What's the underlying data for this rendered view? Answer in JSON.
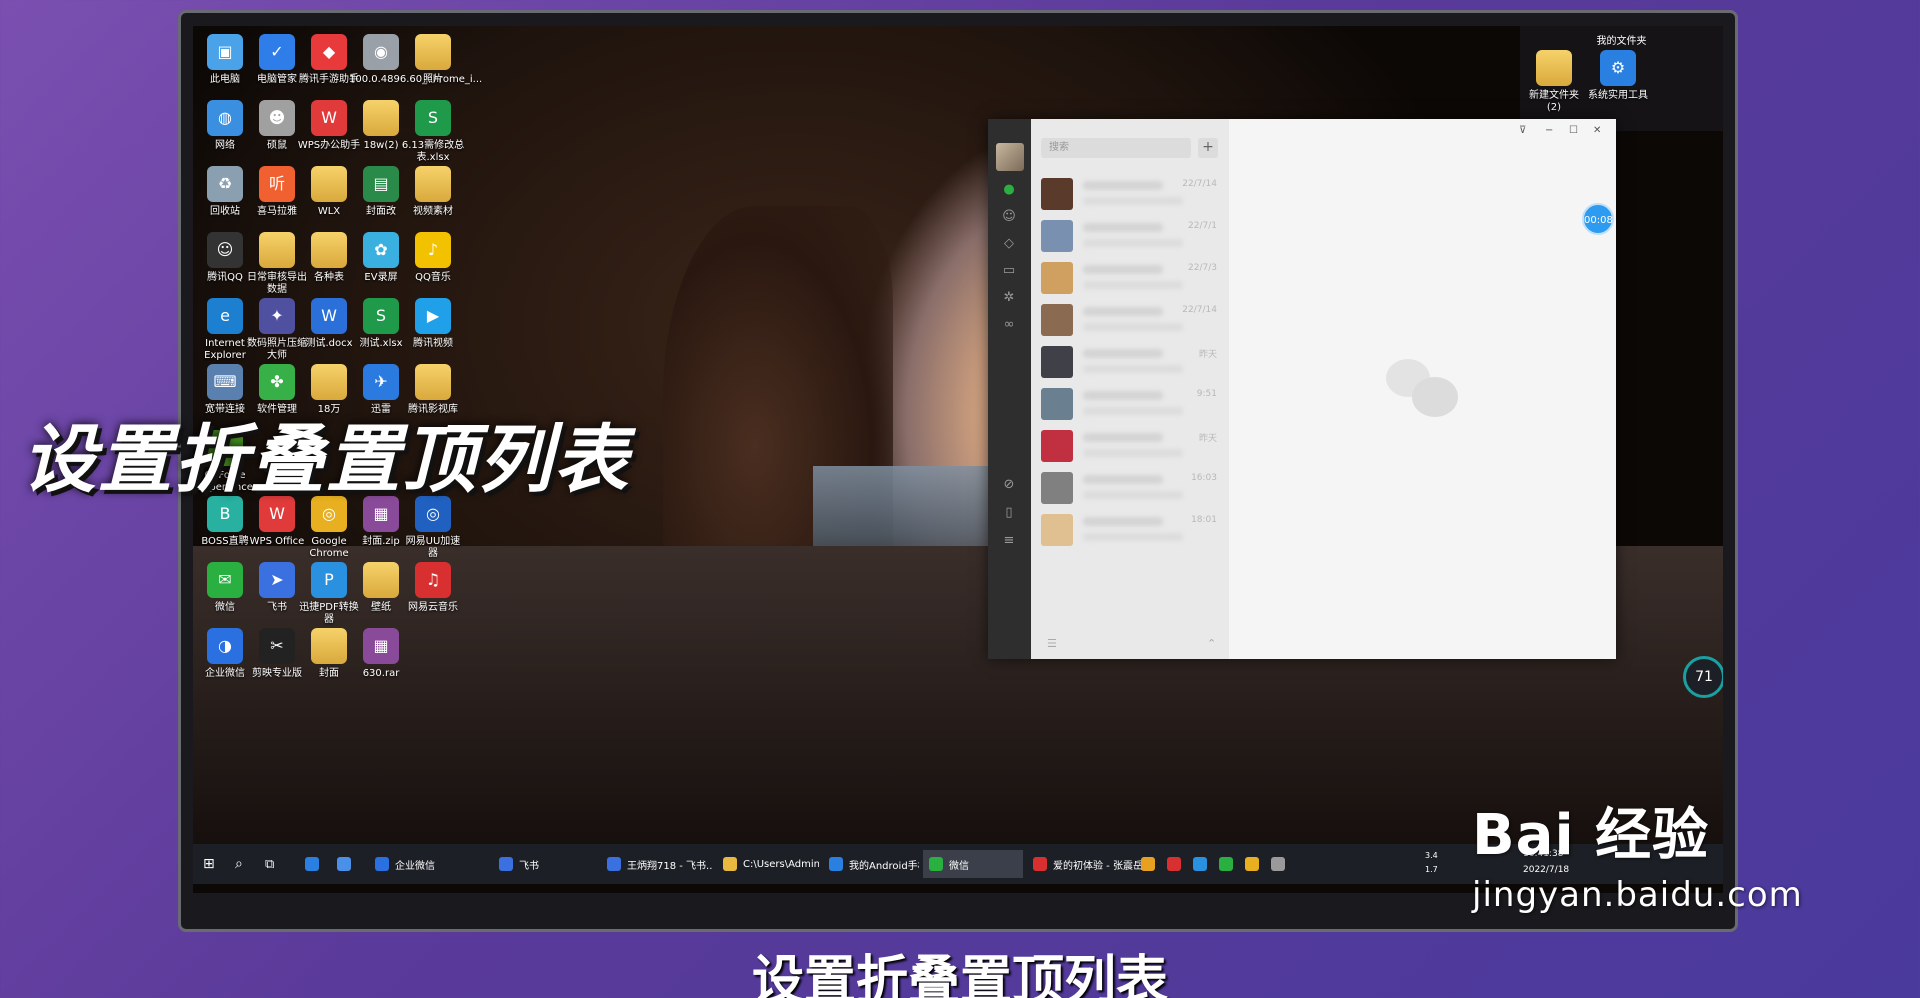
{
  "overlay_title": "设置折叠置顶列表",
  "subtitle": "设置折叠置顶列表",
  "watermark": {
    "brand": "Bai 经验",
    "url": "jingyan.baidu.com"
  },
  "desktop_icons": [
    {
      "label": "此电脑",
      "c": "#4aa3e8",
      "g": "▣"
    },
    {
      "label": "电脑管家",
      "c": "#2e7de9",
      "g": "✓"
    },
    {
      "label": "腾讯手游助手",
      "c": "#e83a3a",
      "g": "◆"
    },
    {
      "label": "100.0.4896.60_chrome_i...",
      "c": "#9aa0a8",
      "g": "◉"
    },
    {
      "label": "照片",
      "c": "folder",
      "g": ""
    },
    {
      "label": "网络",
      "c": "#3a8fe0",
      "g": "◍"
    },
    {
      "label": "硕鼠",
      "c": "#a0a0a0",
      "g": "☻"
    },
    {
      "label": "WPS办公助手",
      "c": "#e03a3a",
      "g": "W"
    },
    {
      "label": "18w(2)",
      "c": "folder",
      "g": ""
    },
    {
      "label": "6.13需修改总表.xlsx",
      "c": "#1f9a4a",
      "g": "S"
    },
    {
      "label": "回收站",
      "c": "#8aa0b0",
      "g": "♻"
    },
    {
      "label": "喜马拉雅",
      "c": "#f06030",
      "g": "听"
    },
    {
      "label": "WLX",
      "c": "folder",
      "g": ""
    },
    {
      "label": "封面改",
      "c": "#2a8a4a",
      "g": "▤"
    },
    {
      "label": "视频素材",
      "c": "folder",
      "g": ""
    },
    {
      "label": "腾讯QQ",
      "c": "#333333",
      "g": "☺"
    },
    {
      "label": "日常审核导出数据",
      "c": "folder",
      "g": ""
    },
    {
      "label": "各种表",
      "c": "folder",
      "g": ""
    },
    {
      "label": "EV录屏",
      "c": "#3ab0e0",
      "g": "✿"
    },
    {
      "label": "QQ音乐",
      "c": "#f2c200",
      "g": "♪"
    },
    {
      "label": "Internet Explorer",
      "c": "#1d7fd0",
      "g": "e"
    },
    {
      "label": "数码照片压缩大师",
      "c": "#5050a0",
      "g": "✦"
    },
    {
      "label": "测试.docx",
      "c": "#2b6fd8",
      "g": "W"
    },
    {
      "label": "测试.xlsx",
      "c": "#1f9a4a",
      "g": "S"
    },
    {
      "label": "腾讯视频",
      "c": "#20a0e8",
      "g": "▶"
    },
    {
      "label": "宽带连接",
      "c": "#5a80b0",
      "g": "⌨"
    },
    {
      "label": "软件管理",
      "c": "#38b048",
      "g": "✤"
    },
    {
      "label": "18万",
      "c": "folder",
      "g": ""
    },
    {
      "label": "迅雷",
      "c": "#2a7ae0",
      "g": "✈"
    },
    {
      "label": "腾讯影视库",
      "c": "folder",
      "g": ""
    },
    {
      "label": "GeForce Experience",
      "c": "#4a9a20",
      "g": "◈"
    },
    {
      "label": "",
      "c": "none",
      "g": ""
    },
    {
      "label": "",
      "c": "none",
      "g": ""
    },
    {
      "label": "",
      "c": "none",
      "g": ""
    },
    {
      "label": "",
      "c": "none",
      "g": ""
    },
    {
      "label": "BOSS直聘",
      "c": "#28b0a0",
      "g": "B"
    },
    {
      "label": "WPS Office",
      "c": "#e03a3a",
      "g": "W"
    },
    {
      "label": "Google Chrome",
      "c": "#e8b020",
      "g": "◎"
    },
    {
      "label": "封面.zip",
      "c": "#8a4a9a",
      "g": "▦"
    },
    {
      "label": "网易UU加速器",
      "c": "#2060c0",
      "g": "◎"
    },
    {
      "label": "微信",
      "c": "#2ab040",
      "g": "✉"
    },
    {
      "label": "飞书",
      "c": "#3a70e0",
      "g": "➤"
    },
    {
      "label": "迅捷PDF转换器",
      "c": "#2a90e0",
      "g": "P"
    },
    {
      "label": "壁纸",
      "c": "folder",
      "g": ""
    },
    {
      "label": "网易云音乐",
      "c": "#d83030",
      "g": "♫"
    },
    {
      "label": "企业微信",
      "c": "#2a70e0",
      "g": "◑"
    },
    {
      "label": "剪映专业版",
      "c": "#222222",
      "g": "✂"
    },
    {
      "label": "封面",
      "c": "folder",
      "g": ""
    },
    {
      "label": "630.rar",
      "c": "#8a4a9a",
      "g": "▦"
    }
  ],
  "top_right_panel": {
    "title": "我的文件夹",
    "items": [
      {
        "label": "新建文件夹(2)"
      },
      {
        "label": "系统实用工具"
      }
    ]
  },
  "taskbar": {
    "items": [
      {
        "label": "企业微信",
        "c": "#2a70e0"
      },
      {
        "label": "飞书",
        "c": "#3a70e0"
      },
      {
        "label": "王炳翔718 - 飞书...",
        "c": "#3a70e0"
      },
      {
        "label": "C:\\Users\\Adminis...",
        "c": "#e8b840"
      },
      {
        "label": "我的Android手机",
        "c": "#2a80e0"
      },
      {
        "label": "微信",
        "c": "#2ab040"
      },
      {
        "label": "爱的初体验 - 张震岳",
        "c": "#d83030"
      }
    ],
    "clock_time": "16:41:38",
    "clock_date": "2022/7/18",
    "gauge_value": "71",
    "net_up": "3.4",
    "net_down": "1.7"
  },
  "wechat": {
    "search_placeholder": "搜索",
    "plus": "+",
    "chats": [
      {
        "time": "22/7/14",
        "av": "#5a3a2a"
      },
      {
        "time": "22/7/1",
        "av": "#7a90b0"
      },
      {
        "time": "22/7/3",
        "av": "#d0a060"
      },
      {
        "time": "22/7/14",
        "av": "#8a6a50"
      },
      {
        "time": "昨天",
        "av": "#404048"
      },
      {
        "time": "9:51",
        "av": "#6a8090"
      },
      {
        "time": "昨天",
        "av": "#c03040"
      },
      {
        "time": "16:03",
        "av": "#808080"
      },
      {
        "time": "18:01",
        "av": "#e0c090"
      }
    ],
    "window_controls": [
      "⊽",
      "−",
      "☐",
      "✕"
    ]
  },
  "timer": "00:08"
}
